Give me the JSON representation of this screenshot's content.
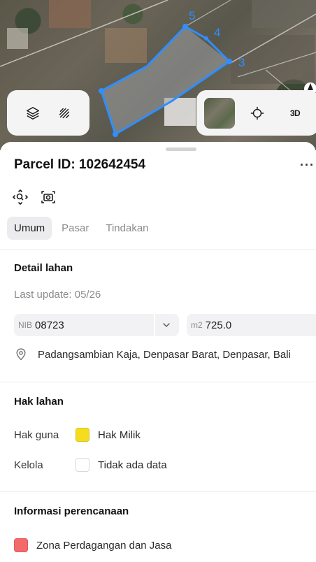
{
  "map": {
    "parcel_vertex_labels": [
      "3",
      "4",
      "5"
    ],
    "layers_button": "layers-icon",
    "draw_button": "draw-icon",
    "locate_button": "crosshair-icon",
    "mode_3d_label": "3D",
    "compass": "compass-icon",
    "parcel_outline_color": "#2f8fff"
  },
  "sheet": {
    "title": "Parcel ID: 102642454",
    "more": "···",
    "actions": [
      "zoom-to-parcel-icon",
      "camera-icon"
    ],
    "tabs": [
      {
        "label": "Umum",
        "active": true
      },
      {
        "label": "Pasar",
        "active": false
      },
      {
        "label": "Tindakan",
        "active": false
      }
    ],
    "detail": {
      "title": "Detail lahan",
      "last_update": "Last update: 05/26",
      "nib_prefix": "NIB",
      "nib_value": "08723",
      "area_prefix": "m2",
      "area_value": "725.0",
      "address": "Padangsambian Kaja, Denpasar Barat, Denpasar, Bali"
    },
    "rights": {
      "title": "Hak lahan",
      "rows": [
        {
          "key": "Hak guna",
          "value": "Hak Milik",
          "color": "#f5dc1e"
        },
        {
          "key": "Kelola",
          "value": "Tidak ada data",
          "color": "#ffffff"
        }
      ]
    },
    "planning": {
      "title": "Informasi perencanaan",
      "zone": "Zona Perdagangan dan Jasa",
      "zone_color": "#f36a6a"
    }
  }
}
